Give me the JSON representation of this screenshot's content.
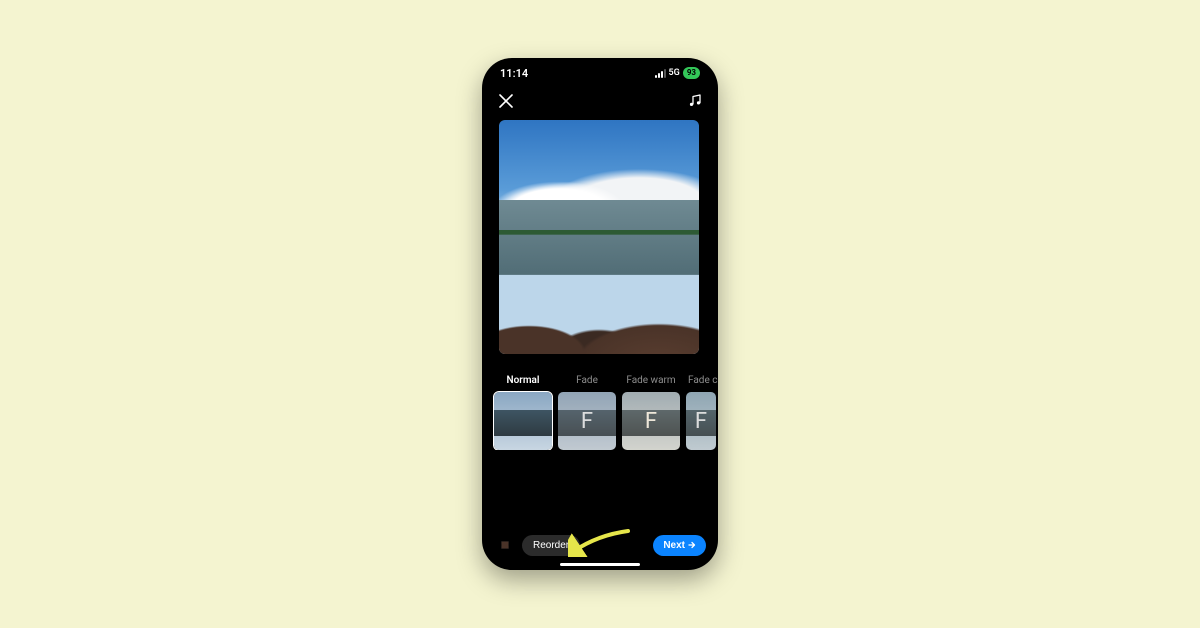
{
  "statusbar": {
    "time": "11:14",
    "network": "5G",
    "battery": "93"
  },
  "filters": [
    {
      "label": "Normal",
      "letter": "",
      "selected": true,
      "style": "normal"
    },
    {
      "label": "Fade",
      "letter": "F",
      "selected": false,
      "style": "fade"
    },
    {
      "label": "Fade warm",
      "letter": "F",
      "selected": false,
      "style": "fadewarm"
    },
    {
      "label": "Fade cool",
      "letter": "F",
      "selected": false,
      "style": "fadecool",
      "partial": true
    }
  ],
  "bottombar": {
    "reorder_label": "Reorder",
    "next_label": "Next"
  },
  "annotation": {
    "arrow_color": "#e6e64a",
    "target": "reorder-button"
  }
}
